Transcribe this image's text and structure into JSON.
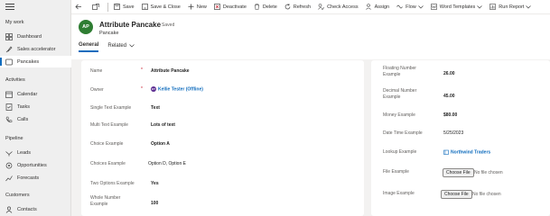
{
  "sitemap": {
    "groups": [
      {
        "label": "My work",
        "items": [
          {
            "label": "Dashboard"
          },
          {
            "label": "Sales accelerator"
          },
          {
            "label": "Pancakes"
          }
        ]
      },
      {
        "label": "Activities",
        "items": [
          {
            "label": "Calendar"
          },
          {
            "label": "Tasks"
          },
          {
            "label": "Calls"
          }
        ]
      },
      {
        "label": "Pipeline",
        "items": [
          {
            "label": "Leads"
          },
          {
            "label": "Opportunities"
          },
          {
            "label": "Forecasts"
          }
        ]
      },
      {
        "label": "Customers",
        "items": [
          {
            "label": "Contacts"
          }
        ]
      }
    ]
  },
  "commands": {
    "save": "Save",
    "save_close": "Save & Close",
    "new": "New",
    "deactivate": "Deactivate",
    "delete": "Delete",
    "refresh": "Refresh",
    "check_access": "Check Access",
    "assign": "Assign",
    "flow": "Flow",
    "word_templates": "Word Templates",
    "run_report": "Run Report"
  },
  "header": {
    "avatar_initials": "AP",
    "title": "Attribute Pancake",
    "saved_status": "- Saved",
    "entity": "Pancake",
    "tabs": [
      "General",
      "Related"
    ]
  },
  "left_fields": {
    "name_label": "Name",
    "name_value": "Attribute Pancake",
    "owner_label": "Owner",
    "owner_avatar": "KT",
    "owner_value": "Kellie Tester (Offline)",
    "single_text_label": "Single Text Example",
    "single_text_value": "Text",
    "multi_text_label": "Multi Text Example",
    "multi_text_value": "Lots of text",
    "choice_label": "Choice Example",
    "choice_value": "Option A",
    "choices_label": "Choices Example",
    "choices_value": "Option D, Option E",
    "two_options_label": "Two Options Example",
    "two_options_value": "Yes",
    "whole_number_label": "Whole Number Example",
    "whole_number_value": "100"
  },
  "right_fields": {
    "floating_label": "Floating Number Example",
    "floating_value": "26.00",
    "decimal_label": "Decimal Number Example",
    "decimal_value": "45.00",
    "money_label": "Money Example",
    "money_value": "$80.00",
    "datetime_label": "Date Time Example",
    "datetime_value": "5/25/2023",
    "lookup_label": "Lookup Example",
    "lookup_value": "Northwind Traders",
    "file_label": "File Example",
    "file_button": "Choose File",
    "file_none": "No file chosen",
    "image_label": "Image Example",
    "image_button": "Choose File",
    "image_none": "No file chosen"
  }
}
